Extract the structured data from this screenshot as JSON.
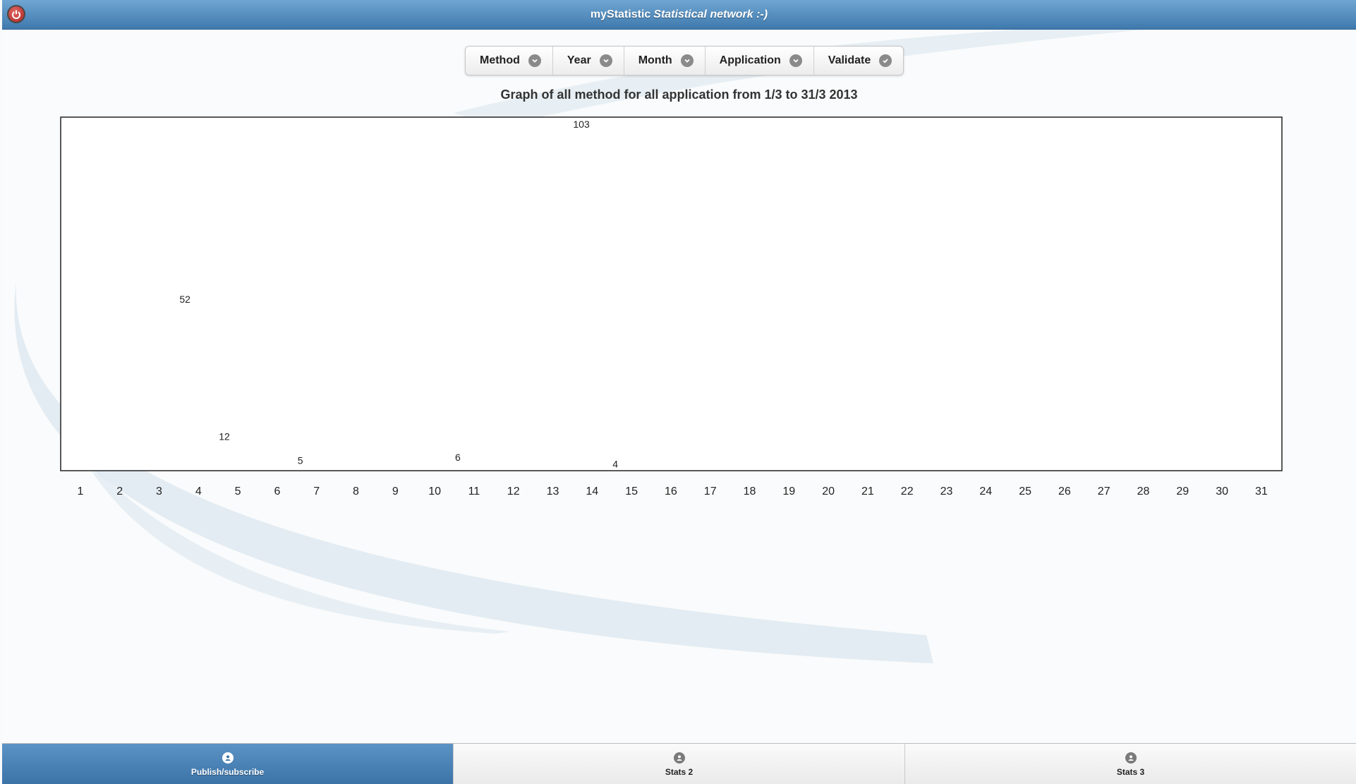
{
  "header": {
    "title_plain": "myStatistic",
    "title_italic": "Statistical network :-)",
    "logout_icon": "power-icon"
  },
  "toolbar": {
    "items": [
      {
        "label": "Method",
        "icon": "chevron-down-icon"
      },
      {
        "label": "Year",
        "icon": "chevron-down-icon"
      },
      {
        "label": "Month",
        "icon": "chevron-down-icon"
      },
      {
        "label": "Application",
        "icon": "chevron-down-icon"
      },
      {
        "label": "Validate",
        "icon": "checkmark-icon"
      }
    ]
  },
  "chart_title": "Graph of all method for all application from 1/3 to 31/3 2013",
  "chart_data": {
    "type": "bar",
    "title": "Graph of all method for all application from 1/3 to 31/3 2013",
    "xlabel": "",
    "ylabel": "",
    "categories": [
      "1",
      "2",
      "3",
      "4",
      "5",
      "6",
      "7",
      "8",
      "9",
      "10",
      "11",
      "12",
      "13",
      "14",
      "15",
      "16",
      "17",
      "18",
      "19",
      "20",
      "21",
      "22",
      "23",
      "24",
      "25",
      "26",
      "27",
      "28",
      "29",
      "30",
      "31"
    ],
    "ylim": [
      0,
      103
    ],
    "grid": false,
    "bars": [
      {
        "category": "4",
        "value": 52,
        "color": "#808000"
      },
      {
        "category": "5",
        "value": 12,
        "color": "#e02000"
      },
      {
        "category": "7",
        "value": 5,
        "color": "#ff0000"
      },
      {
        "category": "11",
        "value": 6,
        "color": "#ff0000"
      },
      {
        "category": "14",
        "value": 103,
        "color": "#00ff00"
      },
      {
        "category": "15",
        "value": 4,
        "color": "#ff0000"
      }
    ]
  },
  "tabs": [
    {
      "label": "Publish/subscribe",
      "active": true,
      "icon": "user-icon"
    },
    {
      "label": "Stats 2",
      "active": false,
      "icon": "user-icon"
    },
    {
      "label": "Stats 3",
      "active": false,
      "icon": "user-icon"
    }
  ],
  "colors": {
    "header_top": "#6fa6d2",
    "header_bottom": "#3f79ad",
    "active_tab": "#4a83b8"
  }
}
